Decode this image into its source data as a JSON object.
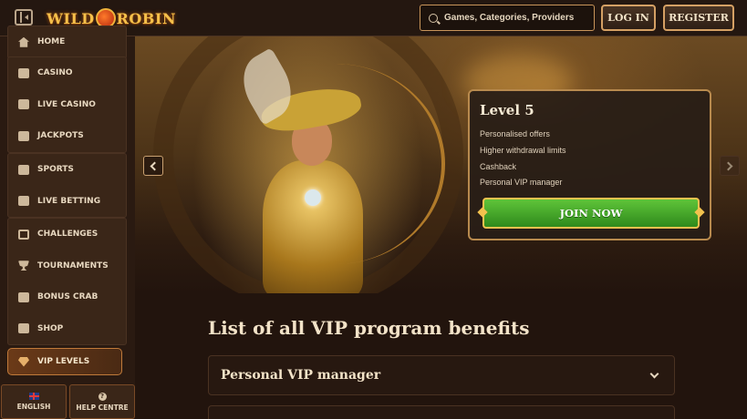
{
  "header": {
    "logo_text_left": "WILD",
    "logo_text_right": "ROBIN",
    "search_placeholder": "Games, Categories, Providers",
    "login_label": "LOG IN",
    "register_label": "REGISTER"
  },
  "sidebar": {
    "groups": [
      {
        "items": [
          {
            "label": "HOME",
            "icon": "home-icon"
          }
        ]
      },
      {
        "items": [
          {
            "label": "CASINO",
            "icon": "casino-icon"
          },
          {
            "label": "LIVE CASINO",
            "icon": "live-casino-icon"
          },
          {
            "label": "JACKPOTS",
            "icon": "jackpot-icon"
          }
        ]
      },
      {
        "items": [
          {
            "label": "SPORTS",
            "icon": "sports-icon"
          },
          {
            "label": "LIVE BETTING",
            "icon": "live-betting-icon"
          }
        ]
      },
      {
        "items": [
          {
            "label": "CHALLENGES",
            "icon": "challenges-icon"
          },
          {
            "label": "TOURNAMENTS",
            "icon": "trophy-icon"
          },
          {
            "label": "BONUS CRAB",
            "icon": "crab-icon"
          },
          {
            "label": "SHOP",
            "icon": "shop-icon"
          }
        ]
      }
    ],
    "vip_label": "VIP LEVELS",
    "language_label": "ENGLISH",
    "help_label": "HELP CENTRE"
  },
  "hero": {
    "level_title": "Level 5",
    "benefits": [
      "Personalised offers",
      "Higher withdrawal limits",
      "Cashback",
      "Personal VIP manager"
    ],
    "cta_label": "JOIN NOW"
  },
  "main": {
    "section_title": "List of all VIP program benefits",
    "accordions": [
      {
        "title": "Personal VIP manager"
      },
      {
        "title": ""
      }
    ]
  },
  "colors": {
    "background": "#1e120c",
    "accent_gold": "#d5a064",
    "cta_green": "#4aa82a"
  }
}
